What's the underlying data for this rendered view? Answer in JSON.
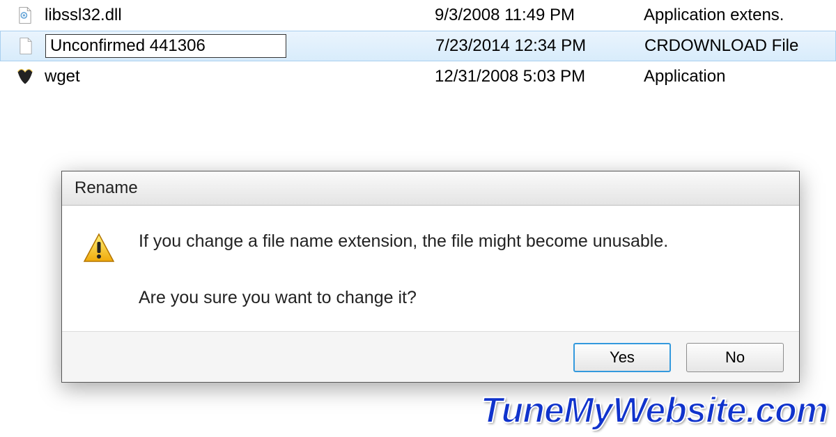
{
  "file_list": {
    "rows": [
      {
        "name": "libssl32.dll",
        "date": "9/3/2008 11:49 PM",
        "type": "Application extens."
      },
      {
        "name": "Unconfirmed 441306",
        "date": "7/23/2014 12:34 PM",
        "type": "CRDOWNLOAD File"
      },
      {
        "name": "wget",
        "date": "12/31/2008 5:03 PM",
        "type": "Application"
      }
    ]
  },
  "rename_dialog": {
    "title": "Rename",
    "message_line1": "If you change a file name extension, the file might become unusable.",
    "message_line2": "Are you sure you want to change it?",
    "yes_label": "Yes",
    "no_label": "No"
  },
  "watermark": "TuneMyWebsite.com"
}
